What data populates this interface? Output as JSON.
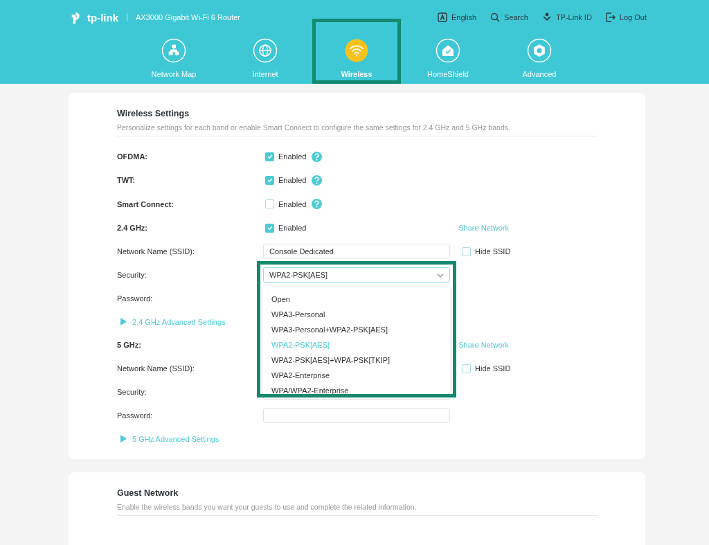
{
  "header": {
    "logo": "tp-link",
    "product": "AX3000 Gigabit Wi-Fi 6 Router",
    "top_links": [
      {
        "label": "English",
        "kind": "language"
      },
      {
        "label": "Search",
        "kind": "search"
      },
      {
        "label": "TP-Link ID",
        "kind": "id"
      },
      {
        "label": "Log Out",
        "kind": "logout"
      }
    ],
    "nav_tabs": [
      {
        "label": "Network Map",
        "kind": "map",
        "selected": false
      },
      {
        "label": "Internet",
        "kind": "globe",
        "selected": false
      },
      {
        "label": "Wireless",
        "kind": "wifi",
        "selected": true
      },
      {
        "label": "HomeShield",
        "kind": "shield",
        "selected": false
      },
      {
        "label": "Advanced",
        "kind": "gear",
        "selected": false
      }
    ]
  },
  "wireless_settings": {
    "title": "Wireless Settings",
    "description": "Personalize settings for each band or enable Smart Connect to configure the same settings for 2.4 GHz and 5 GHz bands.",
    "toggles": [
      {
        "label": "OFDMA:",
        "checkbox_label": "Enabled",
        "checked": true
      },
      {
        "label": "TWT:",
        "checkbox_label": "Enabled",
        "checked": true
      },
      {
        "label": "Smart Connect:",
        "checkbox_label": "Enabled",
        "checked": false
      }
    ],
    "bands": [
      {
        "label": "2.4 GHz:",
        "checkbox_label": "Enabled",
        "checked": true,
        "share_link": "Share Network",
        "ssid_label": "Network Name (SSID):",
        "ssid_value": "Console Dedicated",
        "hide_ssid_label": "Hide SSID",
        "hide_ssid_checked": false,
        "security_label": "Security:",
        "security_value": "WPA2-PSK[AES]",
        "password_label": "Password:",
        "advanced_link": "2.4 GHz Advanced Settings",
        "security_options": [
          {
            "label": "Open",
            "selected": false
          },
          {
            "label": "WPA3-Personal",
            "selected": false
          },
          {
            "label": "WPA3-Personal+WPA2-PSK[AES]",
            "selected": false
          },
          {
            "label": "WPA2-PSK[AES]",
            "selected": true
          },
          {
            "label": "WPA2-PSK[AES]+WPA-PSK[TKIP]",
            "selected": false
          },
          {
            "label": "WPA2-Enterprise",
            "selected": false
          },
          {
            "label": "WPA/WPA2-Enterprise",
            "selected": false
          }
        ]
      },
      {
        "label": "5 GHz:",
        "share_link": "Share Network",
        "ssid_label": "Network Name (SSID):",
        "hide_ssid_label": "Hide SSID",
        "hide_ssid_checked": false,
        "security_label": "Security:",
        "password_label": "Password:",
        "advanced_link": "5 GHz Advanced Settings"
      }
    ]
  },
  "guest_network": {
    "title": "Guest Network",
    "description": "Enable the wireless bands you want your guests to use and complete the related information."
  }
}
